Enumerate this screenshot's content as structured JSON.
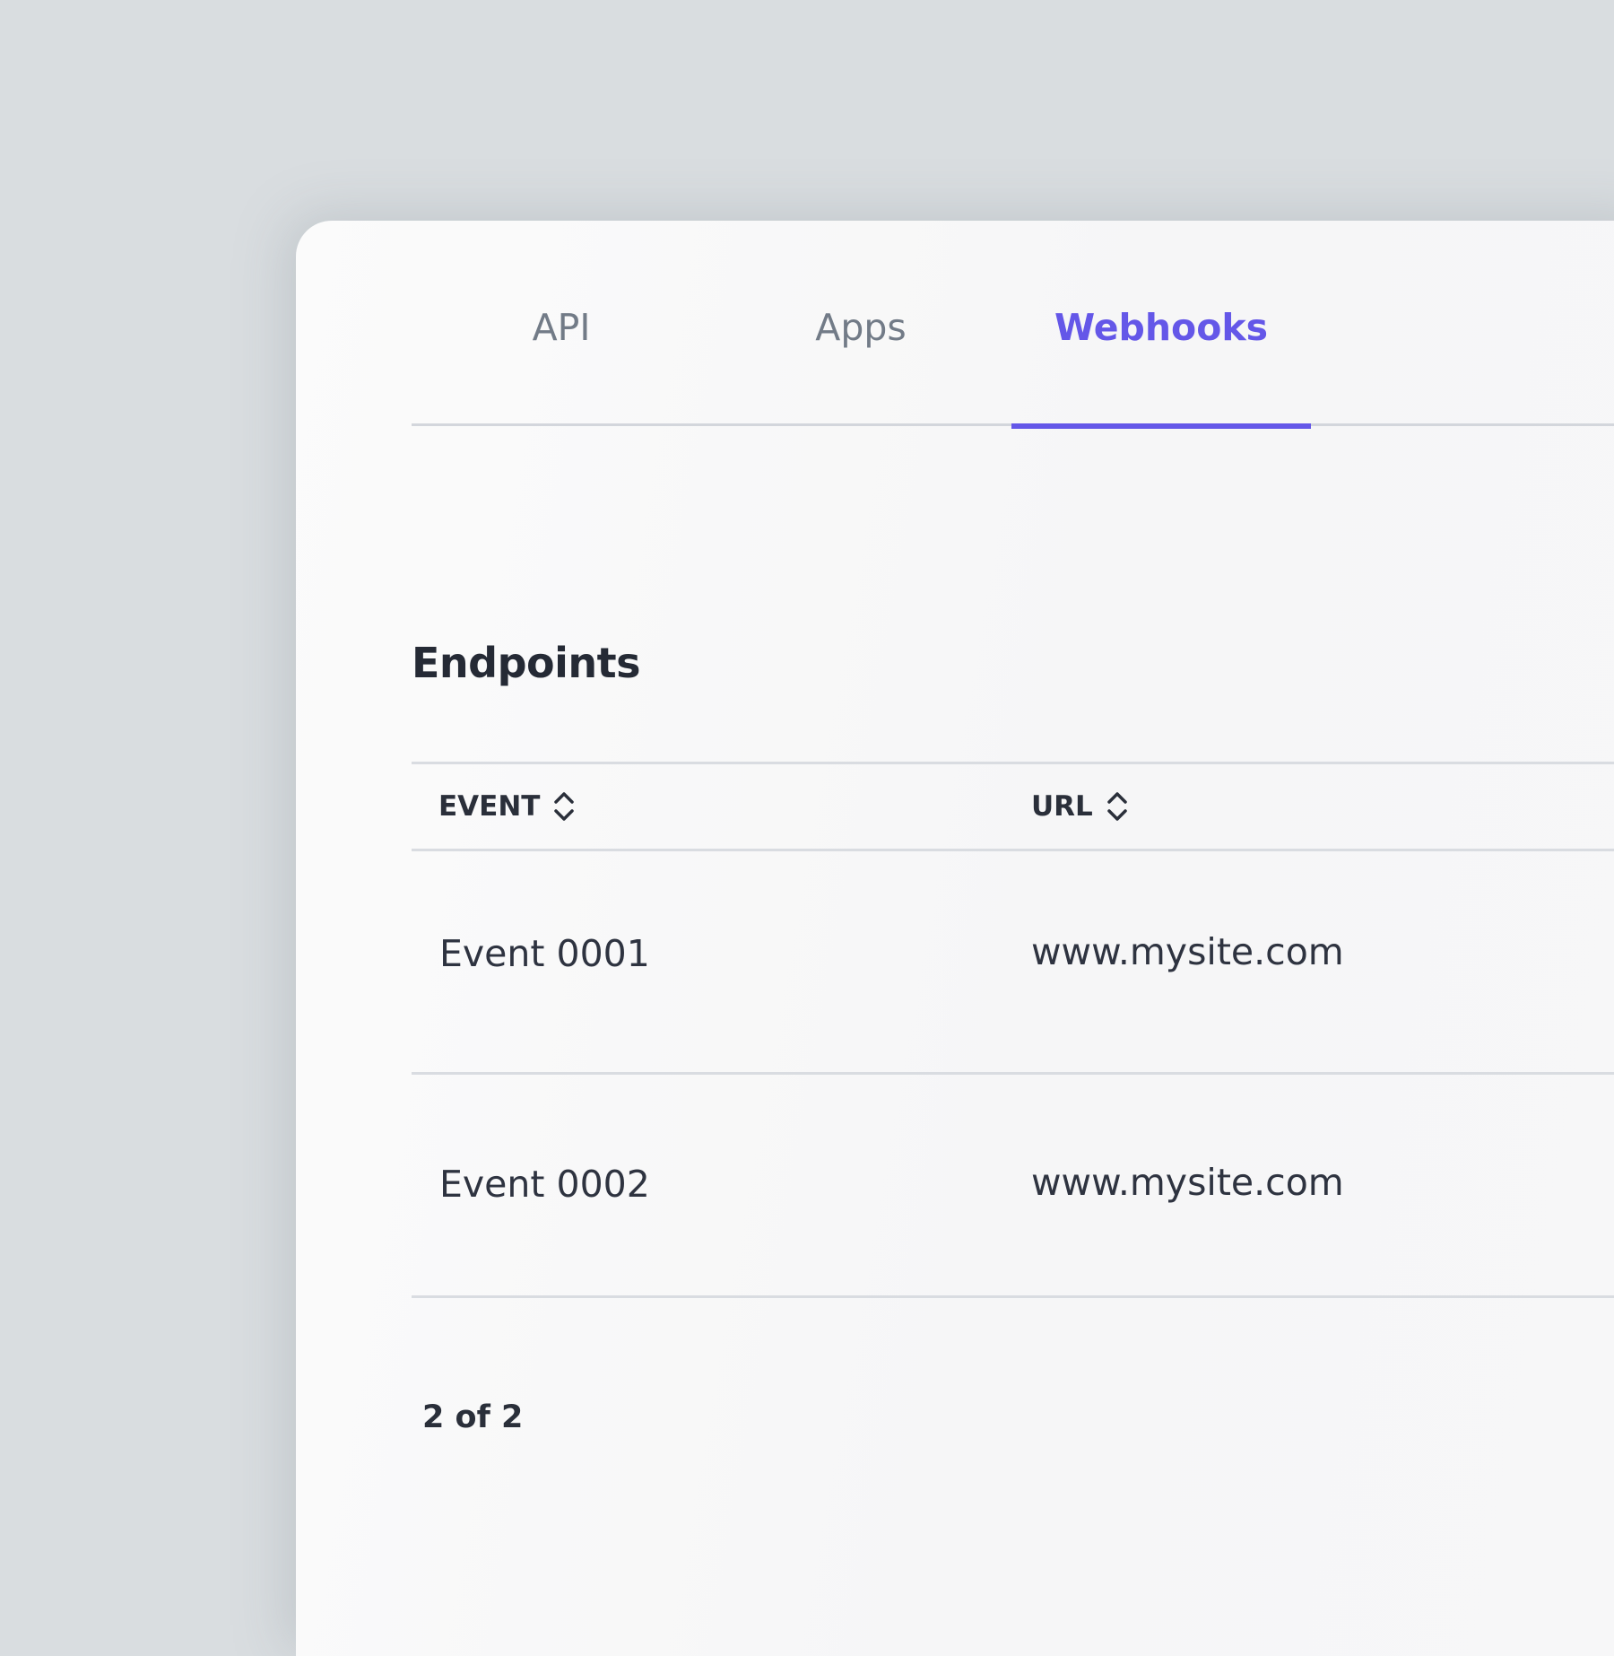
{
  "tabs": [
    {
      "label": "API",
      "active": false
    },
    {
      "label": "Apps",
      "active": false
    },
    {
      "label": "Webhooks",
      "active": true
    }
  ],
  "section": {
    "title": "Endpoints"
  },
  "table": {
    "columns": [
      {
        "label": "EVENT",
        "icon": "sort-icon"
      },
      {
        "label": "URL",
        "icon": "sort-icon"
      }
    ],
    "rows": [
      {
        "event": "Event 0001",
        "url": "www.mysite.com"
      },
      {
        "event": "Event 0002",
        "url": "www.mysite.com"
      }
    ]
  },
  "pagination": {
    "label": "2 of 2"
  },
  "colors": {
    "accent": "#6457e8",
    "background": "#d9dde0",
    "text": "#2a2f3a",
    "muted": "#727b87"
  }
}
